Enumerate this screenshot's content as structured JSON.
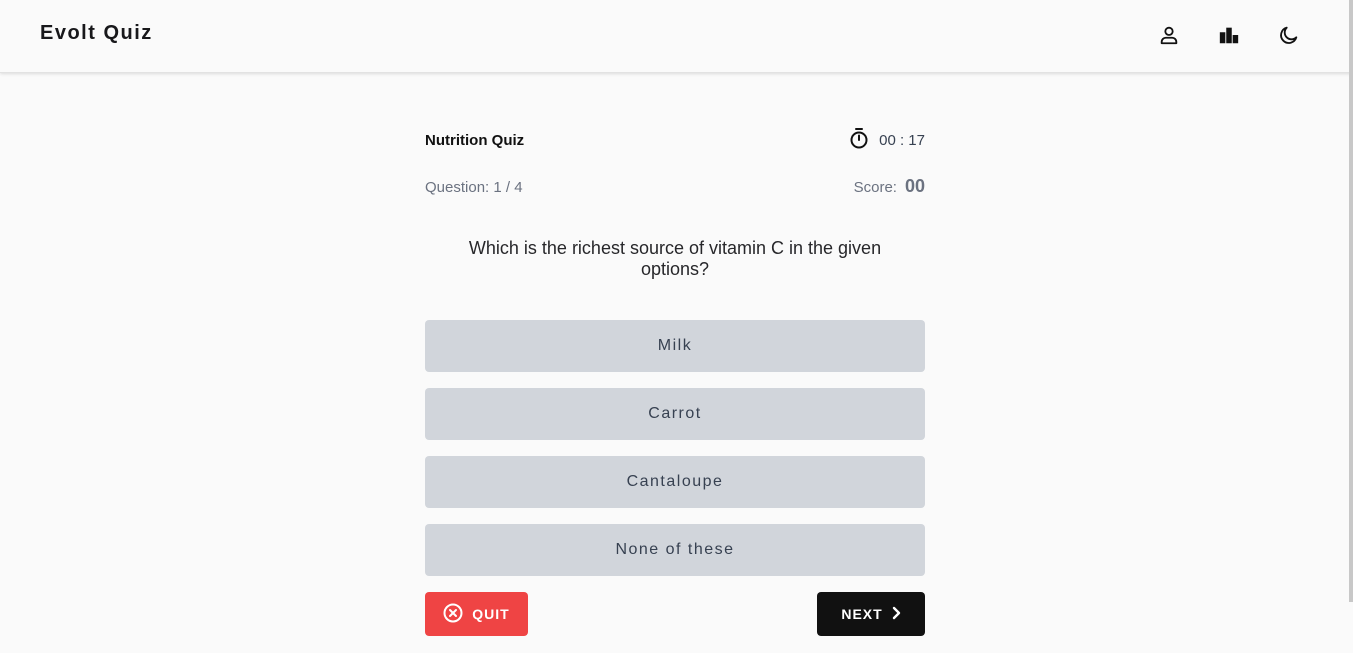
{
  "app": {
    "brand": "Evolt Quiz",
    "nav_icons": [
      "user-icon",
      "leaderboard-icon",
      "moon-icon"
    ]
  },
  "quiz": {
    "title": "Nutrition Quiz",
    "timer": "00 : 17",
    "question_counter": "Question: 1 / 4",
    "score_label": "Score:",
    "score_value": "00",
    "question": "Which is the richest source of vitamin C in the given options?",
    "options": [
      "Milk",
      "Carrot",
      "Cantaloupe",
      "None of these"
    ]
  },
  "actions": {
    "quit_label": "QUIT",
    "next_label": "NEXT"
  },
  "colors": {
    "background": "#fafafa",
    "option_bg": "#d1d5db",
    "quit_bg": "#ef4444",
    "next_bg": "#111111"
  }
}
